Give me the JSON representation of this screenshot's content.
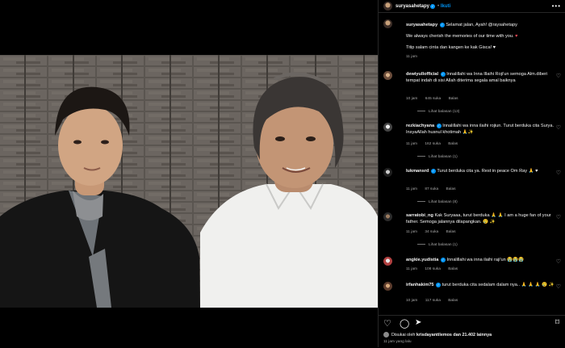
{
  "post": {
    "username": "suryasahetapy",
    "follow_separator": "•",
    "follow_label": "Ikuti",
    "more_label": "•••"
  },
  "caption": {
    "username": "suryasahetapy",
    "line1": "Selamat jalan, Ayah! @raysahetapy",
    "line2": "We always cherish the memories of our time with you.",
    "line2_emoji": "♥",
    "line3": "Titip salam cinta dan kangen ke kak Gisca!",
    "line3_emoji": "♥",
    "time": "11 jam"
  },
  "comments": [
    {
      "username": "dewiyullofficial",
      "text": "Innalillahi wa Inna Illaihi Roji'un semoga Alm.diberi tempat indah di sisi Allah diterima segala amal baiknya",
      "time": "10 jam",
      "likes": "645 suka",
      "reply": "Balas",
      "view_replies": "Lihat balasan (13)"
    },
    {
      "username": "rezkiachyana",
      "text": "Innalillahi wa inna ilaihi rojiun. Turut berduka cita Surya. InsyaAllah husnul khotimah 🙏✨",
      "time": "11 jam",
      "likes": "162 suka",
      "reply": "Balas",
      "view_replies": "Lihat balasan (1)"
    },
    {
      "username": "lukmansrd",
      "text": "Turut berduka cita ya. Rest in peace Om Ray 🙏 ♥",
      "time": "11 jam",
      "likes": "87 suka",
      "reply": "Balas",
      "view_replies": "Lihat balasan (8)"
    },
    {
      "username": "sarratobi_ng",
      "text": "Kak Suryaaa, turut berduka 🙏 🙏 I am a huge fan of your father. Semoga jalannya dilapangkan. 😢 ✨",
      "time": "11 jam",
      "likes": "34 suka",
      "reply": "Balas",
      "view_replies": "Lihat balasan (1)"
    },
    {
      "username": "angkie.yudistia",
      "text": "Innalillahi wa inna ilaihi raji'un 😭😭😭",
      "time": "11 jam",
      "likes": "108 suka",
      "reply": "Balas",
      "view_replies": ""
    },
    {
      "username": "irfanhakim75",
      "text": "turut berduka cita sedalam dalam nya.. 🙏 🙏 🙏 😢 ✨",
      "time": "10 jam",
      "likes": "117 suka",
      "reply": "Balas",
      "view_replies": ""
    }
  ],
  "actions": {
    "liked_by_prefix": "Disukai oleh",
    "liked_by_user": "krisdayantilemos",
    "liked_by_suffix": "dan 21.402 lainnya",
    "time_ago": "11 jam yang lalu"
  },
  "colors": {
    "background": "#000000",
    "link_blue": "#0095f6",
    "heart_red": "#ed4956",
    "muted": "#a8a8a8"
  }
}
